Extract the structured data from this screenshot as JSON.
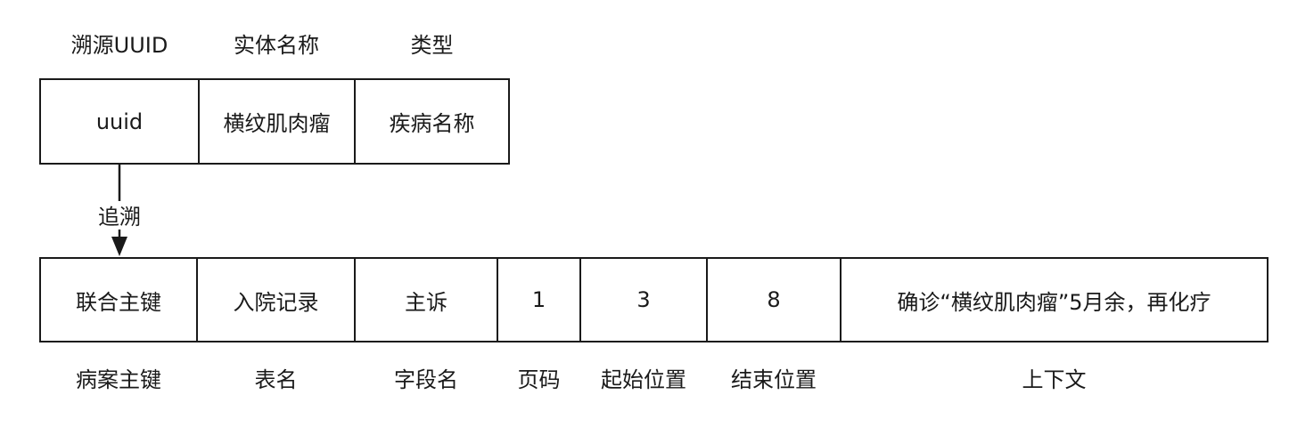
{
  "source_record": {
    "headers": [
      "溯源UUID",
      "实体名称",
      "类型"
    ],
    "values": [
      "uuid",
      "横纹肌肉瘤",
      "疾病名称"
    ]
  },
  "trace_link": {
    "label": "追溯"
  },
  "target_record": {
    "values": [
      "联合主键",
      "入院记录",
      "主诉",
      "1",
      "3",
      "8",
      "确诊“横纹肌肉瘤”5月余，再化疗"
    ],
    "footers": [
      "病案主键",
      "表名",
      "字段名",
      "页码",
      "起始位置",
      "结束位置",
      "上下文"
    ]
  },
  "colors": {
    "stroke": "#1a1a1a",
    "background": "#ffffff"
  }
}
